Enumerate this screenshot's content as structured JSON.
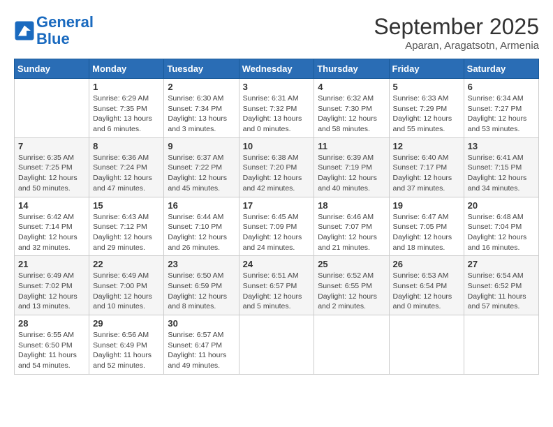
{
  "header": {
    "logo_line1": "General",
    "logo_line2": "Blue",
    "month_title": "September 2025",
    "subtitle": "Aparan, Aragatsotn, Armenia"
  },
  "days_of_week": [
    "Sunday",
    "Monday",
    "Tuesday",
    "Wednesday",
    "Thursday",
    "Friday",
    "Saturday"
  ],
  "weeks": [
    [
      {
        "number": "",
        "info": ""
      },
      {
        "number": "1",
        "info": "Sunrise: 6:29 AM\nSunset: 7:35 PM\nDaylight: 13 hours\nand 6 minutes."
      },
      {
        "number": "2",
        "info": "Sunrise: 6:30 AM\nSunset: 7:34 PM\nDaylight: 13 hours\nand 3 minutes."
      },
      {
        "number": "3",
        "info": "Sunrise: 6:31 AM\nSunset: 7:32 PM\nDaylight: 13 hours\nand 0 minutes."
      },
      {
        "number": "4",
        "info": "Sunrise: 6:32 AM\nSunset: 7:30 PM\nDaylight: 12 hours\nand 58 minutes."
      },
      {
        "number": "5",
        "info": "Sunrise: 6:33 AM\nSunset: 7:29 PM\nDaylight: 12 hours\nand 55 minutes."
      },
      {
        "number": "6",
        "info": "Sunrise: 6:34 AM\nSunset: 7:27 PM\nDaylight: 12 hours\nand 53 minutes."
      }
    ],
    [
      {
        "number": "7",
        "info": "Sunrise: 6:35 AM\nSunset: 7:25 PM\nDaylight: 12 hours\nand 50 minutes."
      },
      {
        "number": "8",
        "info": "Sunrise: 6:36 AM\nSunset: 7:24 PM\nDaylight: 12 hours\nand 47 minutes."
      },
      {
        "number": "9",
        "info": "Sunrise: 6:37 AM\nSunset: 7:22 PM\nDaylight: 12 hours\nand 45 minutes."
      },
      {
        "number": "10",
        "info": "Sunrise: 6:38 AM\nSunset: 7:20 PM\nDaylight: 12 hours\nand 42 minutes."
      },
      {
        "number": "11",
        "info": "Sunrise: 6:39 AM\nSunset: 7:19 PM\nDaylight: 12 hours\nand 40 minutes."
      },
      {
        "number": "12",
        "info": "Sunrise: 6:40 AM\nSunset: 7:17 PM\nDaylight: 12 hours\nand 37 minutes."
      },
      {
        "number": "13",
        "info": "Sunrise: 6:41 AM\nSunset: 7:15 PM\nDaylight: 12 hours\nand 34 minutes."
      }
    ],
    [
      {
        "number": "14",
        "info": "Sunrise: 6:42 AM\nSunset: 7:14 PM\nDaylight: 12 hours\nand 32 minutes."
      },
      {
        "number": "15",
        "info": "Sunrise: 6:43 AM\nSunset: 7:12 PM\nDaylight: 12 hours\nand 29 minutes."
      },
      {
        "number": "16",
        "info": "Sunrise: 6:44 AM\nSunset: 7:10 PM\nDaylight: 12 hours\nand 26 minutes."
      },
      {
        "number": "17",
        "info": "Sunrise: 6:45 AM\nSunset: 7:09 PM\nDaylight: 12 hours\nand 24 minutes."
      },
      {
        "number": "18",
        "info": "Sunrise: 6:46 AM\nSunset: 7:07 PM\nDaylight: 12 hours\nand 21 minutes."
      },
      {
        "number": "19",
        "info": "Sunrise: 6:47 AM\nSunset: 7:05 PM\nDaylight: 12 hours\nand 18 minutes."
      },
      {
        "number": "20",
        "info": "Sunrise: 6:48 AM\nSunset: 7:04 PM\nDaylight: 12 hours\nand 16 minutes."
      }
    ],
    [
      {
        "number": "21",
        "info": "Sunrise: 6:49 AM\nSunset: 7:02 PM\nDaylight: 12 hours\nand 13 minutes."
      },
      {
        "number": "22",
        "info": "Sunrise: 6:49 AM\nSunset: 7:00 PM\nDaylight: 12 hours\nand 10 minutes."
      },
      {
        "number": "23",
        "info": "Sunrise: 6:50 AM\nSunset: 6:59 PM\nDaylight: 12 hours\nand 8 minutes."
      },
      {
        "number": "24",
        "info": "Sunrise: 6:51 AM\nSunset: 6:57 PM\nDaylight: 12 hours\nand 5 minutes."
      },
      {
        "number": "25",
        "info": "Sunrise: 6:52 AM\nSunset: 6:55 PM\nDaylight: 12 hours\nand 2 minutes."
      },
      {
        "number": "26",
        "info": "Sunrise: 6:53 AM\nSunset: 6:54 PM\nDaylight: 12 hours\nand 0 minutes."
      },
      {
        "number": "27",
        "info": "Sunrise: 6:54 AM\nSunset: 6:52 PM\nDaylight: 11 hours\nand 57 minutes."
      }
    ],
    [
      {
        "number": "28",
        "info": "Sunrise: 6:55 AM\nSunset: 6:50 PM\nDaylight: 11 hours\nand 54 minutes."
      },
      {
        "number": "29",
        "info": "Sunrise: 6:56 AM\nSunset: 6:49 PM\nDaylight: 11 hours\nand 52 minutes."
      },
      {
        "number": "30",
        "info": "Sunrise: 6:57 AM\nSunset: 6:47 PM\nDaylight: 11 hours\nand 49 minutes."
      },
      {
        "number": "",
        "info": ""
      },
      {
        "number": "",
        "info": ""
      },
      {
        "number": "",
        "info": ""
      },
      {
        "number": "",
        "info": ""
      }
    ]
  ]
}
